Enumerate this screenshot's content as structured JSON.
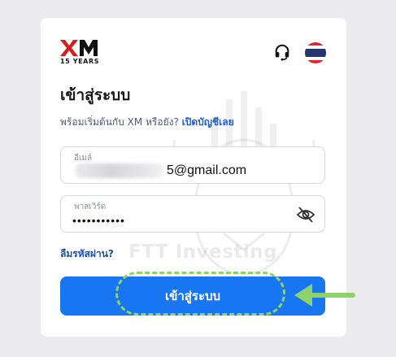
{
  "brand": {
    "logo_text": "XM",
    "logo_sub": "15 YEARS"
  },
  "header": {
    "support_icon": "headset-icon",
    "language_icon": "thailand-flag-icon"
  },
  "login": {
    "title": "เข้าสู่ระบบ",
    "signup_prompt": "พร้อมเริ่มต้นกับ XM หรือยัง?",
    "signup_link": "เปิดบัญชีเลย",
    "email_label": "อีเมล์",
    "email_value": "5@gmail.com",
    "password_label": "พาสเวิร์ด",
    "password_value": "•••••••••••",
    "forgot_label": "ลืมรหัสผ่าน?",
    "submit_label": "เข้าสู่ระบบ"
  },
  "watermark": {
    "text": "FTT Investing"
  },
  "colors": {
    "primary": "#1876f2",
    "link": "#1a5ed8",
    "highlight": "#8ed36a",
    "brand_red": "#d51e1e"
  }
}
